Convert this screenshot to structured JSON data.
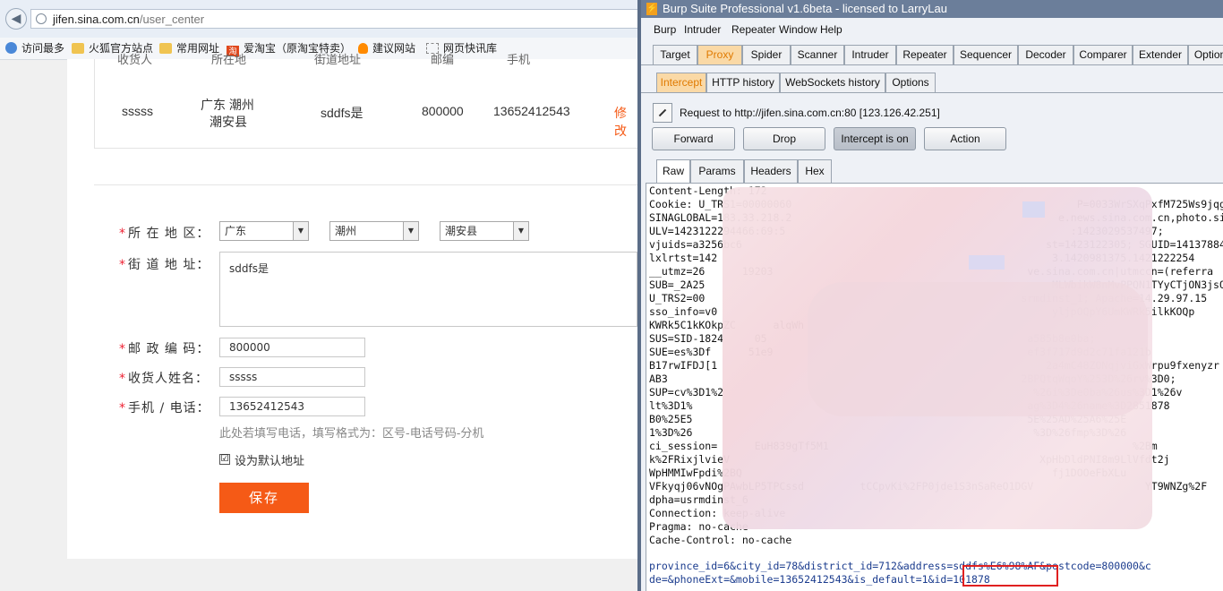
{
  "browser": {
    "url_domain": "jifen.sina.com.cn",
    "url_path": "/user_center",
    "bookmarks": [
      "访问最多",
      "火狐官方站点",
      "常用网址",
      "爱淘宝（原淘宝特卖）",
      "建议网站",
      "网页快讯库"
    ],
    "bookmark_icons": [
      "gear-icon",
      "folder-icon",
      "folder-icon",
      "taobao-icon",
      "bulb-icon",
      "web-slice-icon"
    ]
  },
  "address_table": {
    "headers": [
      "收货人",
      "所在地",
      "街道地址",
      "邮编",
      "手机"
    ],
    "row": {
      "name": "sssss",
      "region_line1": "广东 潮州",
      "region_line2": "潮安县",
      "street": "sddfs是",
      "zip": "800000",
      "phone": "13652412543",
      "action": "修改"
    }
  },
  "form": {
    "region_label": "所 在 地 区：",
    "province": "广东",
    "city": "潮州",
    "district": "潮安县",
    "street_label": "街 道 地 址：",
    "street_value": "sddfs是",
    "zip_label": "邮 政 编 码：",
    "zip_value": "800000",
    "name_label": "收货人姓名：",
    "name_value": "sssss",
    "phone_label": "手机 / 电话：",
    "phone_value": "13652412543",
    "phone_hint": "此处若填写电话，填写格式为：区号-电话号码-分机",
    "default_label": "设为默认地址",
    "default_checked": "☑",
    "save_label": "保存"
  },
  "burp": {
    "title": "Burp Suite Professional v1.6beta - licensed to LarryLau",
    "menu": [
      "Burp",
      "Intruder",
      "Repeater",
      "Window",
      "Help"
    ],
    "main_tabs": [
      "Target",
      "Proxy",
      "Spider",
      "Scanner",
      "Intruder",
      "Repeater",
      "Sequencer",
      "Decoder",
      "Comparer",
      "Extender",
      "Options"
    ],
    "proxy_tabs": [
      "Intercept",
      "HTTP history",
      "WebSockets history",
      "Options"
    ],
    "request_info": "Request to http://jifen.sina.com.cn:80  [123.126.42.251]",
    "buttons": {
      "forward": "Forward",
      "drop": "Drop",
      "intercept": "Intercept is on",
      "action": "Action"
    },
    "view_tabs": [
      "Raw",
      "Params",
      "Headers",
      "Hex"
    ],
    "raw_lines": [
      "Content-Length: 172",
      "Cookie: U_TRS1=00000060                                              P=0033WrSXqPxfM725Ws9jqgMR",
      "SINAGLOBAL=183.33.218.2                                           e.news.sina.com.cn,photo.sin",
      "ULV=1423122294466:69:5                                              :1423029537497;",
      "vjuids=a3256bc6                                                 st=1423122305; SGUID=141378845",
      "lxlrtst=142                                                      3.1420981375.1421222254",
      "__utmz=26      19203                                         ve.sina.com.cn|utmccn=(referra",
      "SUB=_2A25                                                        MLWbikW8nMvPPQN1TYyCTjON3jsQ",
      "U_TRS2=00                                                   srmdinst_1; Apache=14.29.97.15",
      "sso_info=v0                                                      yljpOQpY6UmKWRk5ilkKOQp",
      "KWRk5C1kKOkpZC      alqWh",
      "SUS=SID-1824     05                                          a585b8e0ba;",
      "SUE=es%3Df      51e9                                         ef3f717d9d2c71fa121b",
      "B17rwIFDJ[1                                                     2a4mC48ZONqjviGxWrpu9fxenyzr",
      "AB3                                                         2BPQtqWqoY%253D%26rv%3D0;",
      "SUP=cv%3D1%2                                                  %26i%3De0ba%26us%3D1%26v",
      "lt%3D1%                                                      ag%3D4%26name%3D2851878",
      "B0%25E5                                                      5E%25AD%25A6%25E",
      "1%3D%26                                                       %3D%26fmp%3D%26",
      "ci_session=      EuH839gTf5M1                                                 %2Bm",
      "k%2FRixjlvieV                                                  XpHbDldPNI8m9LlVfdt2j",
      "WpHMMIwFpdi%2BQ                                                  fj1DOOeFbXLu",
      "VFkyqj06vNOgPAwbLP5TPCssd         tCCpvKi%2FP0jde1S3nSaReO1DGV                  YT9WNZg%2F",
      "dpha=usrmdinst_6",
      "Connection: keep-alive",
      "Pragma: no-cache",
      "Cache-Control: no-cache"
    ],
    "body_line1": "province_id=6&city_id=78&district_id=712&address=sddfs%E6%98%AF&postcode=800000&c",
    "body_line2": "de=&phoneExt=&mobile=13652412543&is_default=1&id=101878"
  }
}
